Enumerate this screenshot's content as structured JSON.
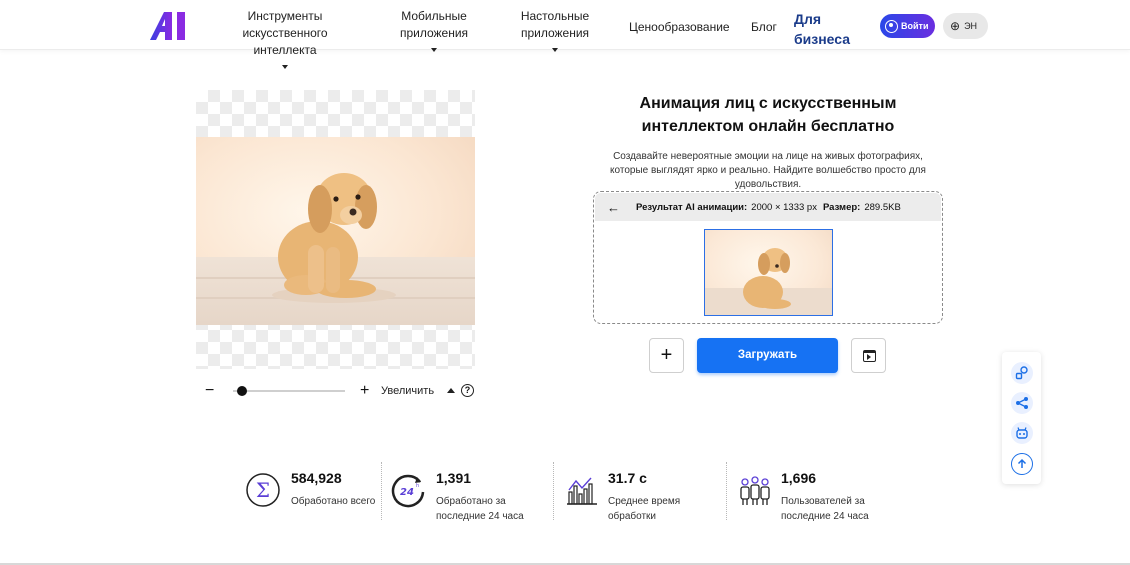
{
  "header": {
    "logo_text": "AI",
    "nav": [
      {
        "label": "Инструменты искусственного интеллекта"
      },
      {
        "label": "Мобильные приложения"
      },
      {
        "label": "Настольные приложения"
      },
      {
        "label": "Ценообразование"
      },
      {
        "label": "Блог"
      },
      {
        "label": "Для бизнеса"
      }
    ],
    "login_label": "Войти",
    "lang_label": "ЭН"
  },
  "editor": {
    "zoom_label": "Увеличить",
    "zoom_level": 0.08,
    "help_label": "?"
  },
  "hero": {
    "title": "Анимация лиц с искусственным интеллектом онлайн бесплатно",
    "description": "Создавайте невероятные эмоции на лице на живых фотографиях, которые выглядят ярко и реально. Найдите волшебство просто для удовольствия."
  },
  "result": {
    "label": "Результат AI анимации:",
    "dimensions": "2000 × 1333 px",
    "size_label": "Размер:",
    "size_value": "289.5KB"
  },
  "actions": {
    "upload_label": "Загружать",
    "add_label": "+"
  },
  "stats": [
    {
      "value": "584,928",
      "label": "Обработано всего",
      "icon": "sigma-icon"
    },
    {
      "value": "1,391",
      "label": "Обработано за последние 24 часа",
      "icon": "clock-24-icon"
    },
    {
      "value": "31.7 с",
      "label": "Среднее время обработки",
      "icon": "bar-chart-icon"
    },
    {
      "value": "1,696",
      "label": "Пользователей за последние 24 часа",
      "icon": "users-icon"
    }
  ],
  "side_rail": [
    "link-icon",
    "share-icon",
    "robot-icon",
    "arrow-up-icon"
  ],
  "colors": {
    "accent": "#1672f3",
    "logo_start": "#2a47e8",
    "logo_end": "#8a2be2",
    "business": "#1a3b8a"
  }
}
